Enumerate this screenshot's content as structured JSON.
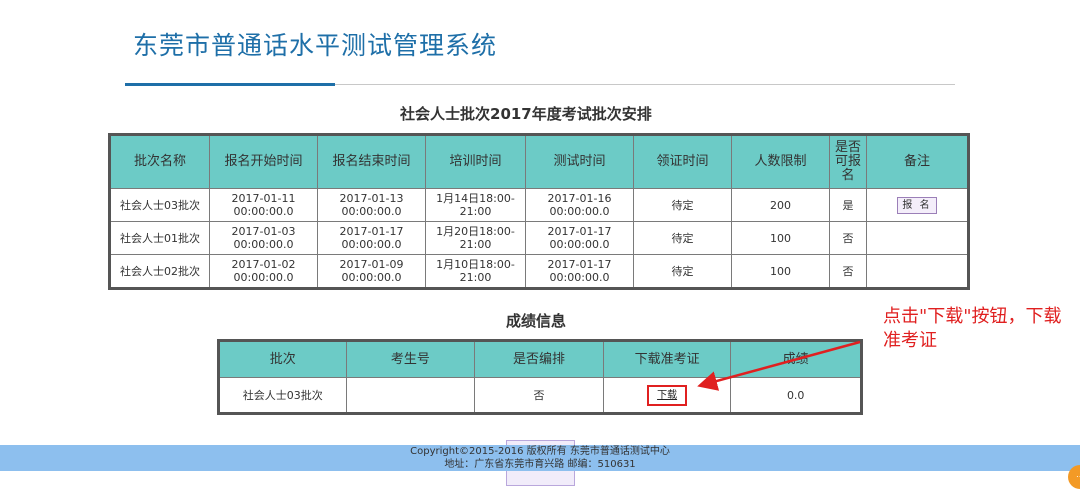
{
  "header": {
    "title": "东莞市普通话水平测试管理系统"
  },
  "batches": {
    "title": "社会人士批次2017年度考试批次安排",
    "columns": [
      "批次名称",
      "报名开始时间",
      "报名结束时间",
      "培训时间",
      "测试时间",
      "领证时间",
      "人数限制",
      "是否可报名",
      "备注"
    ],
    "rows": [
      {
        "name": "社会人士03批次",
        "reg_start": [
          "2017-01-11",
          "00:00:00.0"
        ],
        "reg_end": [
          "2017-01-13",
          "00:00:00.0"
        ],
        "training": "1月14日18:00-21:00",
        "test": [
          "2017-01-16",
          "00:00:00.0"
        ],
        "cert": "待定",
        "limit": "200",
        "open": "是",
        "remark_button": "报 名"
      },
      {
        "name": "社会人士01批次",
        "reg_start": [
          "2017-01-03",
          "00:00:00.0"
        ],
        "reg_end": [
          "2017-01-17",
          "00:00:00.0"
        ],
        "training": "1月20日18:00-21:00",
        "test": [
          "2017-01-17",
          "00:00:00.0"
        ],
        "cert": "待定",
        "limit": "100",
        "open": "否",
        "remark_button": ""
      },
      {
        "name": "社会人士02批次",
        "reg_start": [
          "2017-01-02",
          "00:00:00.0"
        ],
        "reg_end": [
          "2017-01-09",
          "00:00:00.0"
        ],
        "training": "1月10日18:00-21:00",
        "test": [
          "2017-01-17",
          "00:00:00.0"
        ],
        "cert": "待定",
        "limit": "100",
        "open": "否",
        "remark_button": ""
      }
    ]
  },
  "scores": {
    "title": "成绩信息",
    "columns": [
      "批次",
      "考生号",
      "是否编排",
      "下载准考证",
      "成绩"
    ],
    "rows": [
      {
        "batch": "社会人士03批次",
        "exam_no": "",
        "arranged": "否",
        "download": "下载",
        "score": "0.0"
      }
    ]
  },
  "annotation": {
    "text": "点击\"下载\"按钮，下载准考证"
  },
  "footer": {
    "copyright": "Copyright©2015-2016 版权所有 东莞市普通话测试中心",
    "address": "地址：广东省东莞市育兴路 邮编：510631"
  },
  "colors": {
    "title": "#1e6fa8",
    "header_cell": "#6ccbc6",
    "annotation": "#e02020",
    "footer": "#8dbfee"
  }
}
